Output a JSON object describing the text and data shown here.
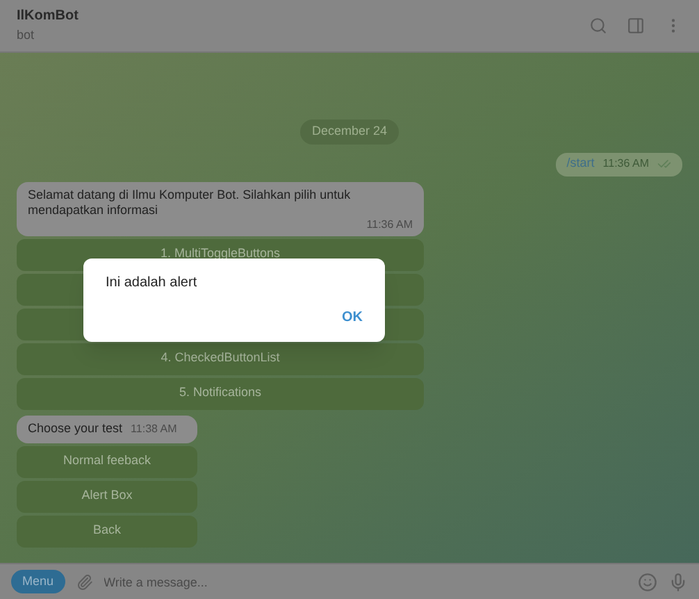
{
  "header": {
    "title": "IlKomBot",
    "subtitle": "bot"
  },
  "date_label": "December 24",
  "messages": [
    {
      "kind": "outgoing",
      "text": "/start",
      "time": "11:36 AM",
      "read": true
    },
    {
      "kind": "incoming",
      "text": "Selamat datang di Ilmu Komputer Bot. Silahkan pilih  untuk mendapatkan informasi",
      "time": "11:36 AM",
      "buttons": [
        {
          "kind": "button",
          "label": "1. MultiToggleButtons"
        },
        {
          "kind": "hidden"
        },
        {
          "kind": "hidden"
        },
        {
          "kind": "button",
          "label": "4. CheckedButtonList"
        },
        {
          "kind": "button",
          "label": "5. Notifications"
        }
      ]
    },
    {
      "kind": "incoming",
      "text": "Choose your test",
      "time": "11:38 AM",
      "buttons": [
        {
          "kind": "button",
          "label": "Normal feeback"
        },
        {
          "kind": "button",
          "label": "Alert Box"
        },
        {
          "kind": "button",
          "label": "Back"
        }
      ]
    }
  ],
  "dialog": {
    "message": "Ini adalah alert",
    "button": "OK"
  },
  "composer": {
    "menu_button": "Menu",
    "placeholder": "Write a message..."
  }
}
